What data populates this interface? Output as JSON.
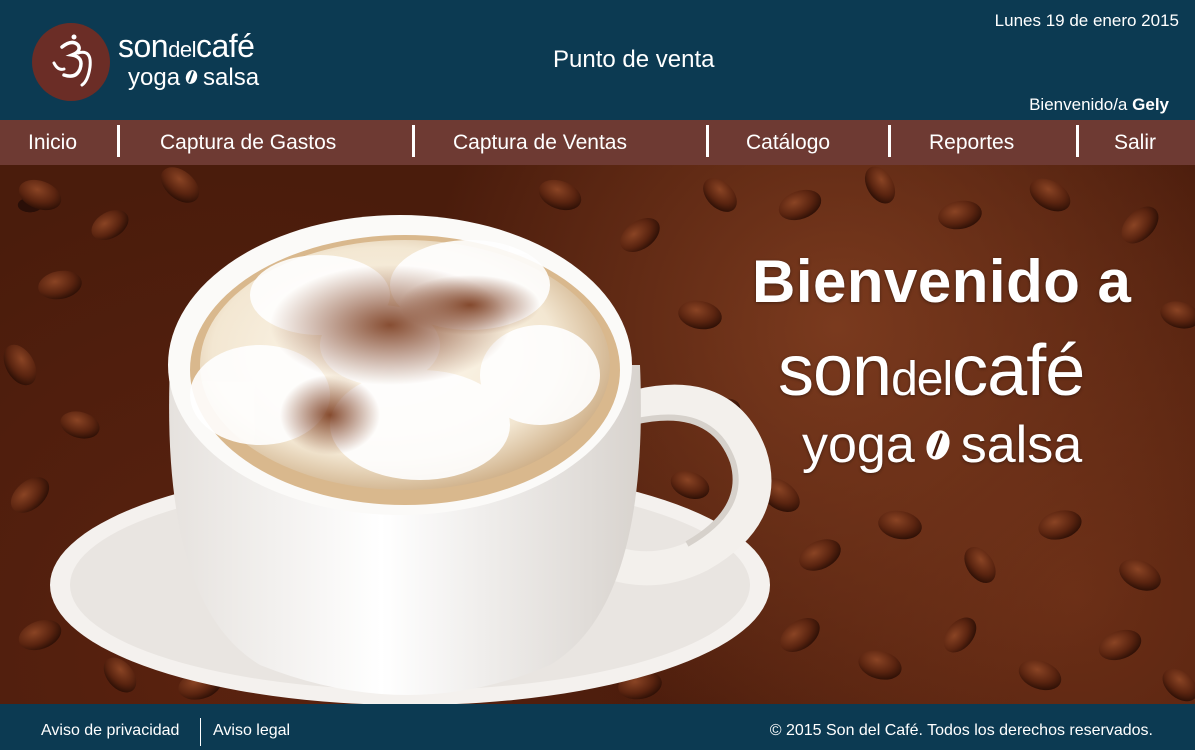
{
  "header": {
    "logo": {
      "brand_main": "son",
      "brand_small": "del",
      "brand_end": "café",
      "brand_sub_left": "yoga",
      "brand_sub_right": "salsa"
    },
    "app_title": "Punto de venta",
    "date": "Lunes 19 de enero 2015",
    "welcome_prefix": "Bienvenido/a",
    "user_name": "Gely"
  },
  "nav": {
    "items": [
      {
        "label": "Inicio"
      },
      {
        "label": "Captura de Gastos"
      },
      {
        "label": "Captura de Ventas"
      },
      {
        "label": "Catálogo"
      },
      {
        "label": "Reportes"
      },
      {
        "label": "Salir"
      }
    ]
  },
  "hero": {
    "title": "Bienvenido a",
    "brand_main": "son",
    "brand_small": "del",
    "brand_end": "café",
    "brand_sub_left": "yoga",
    "brand_sub_right": "salsa"
  },
  "footer": {
    "privacy_label": "Aviso de privacidad",
    "legal_label": "Aviso legal",
    "copyright": "© 2015 Son del Café. Todos los derechos reservados."
  },
  "colors": {
    "header_bg": "#0c3a52",
    "nav_bg": "#6e3a33",
    "logo_badge": "#6b2d26",
    "text": "#ffffff"
  }
}
